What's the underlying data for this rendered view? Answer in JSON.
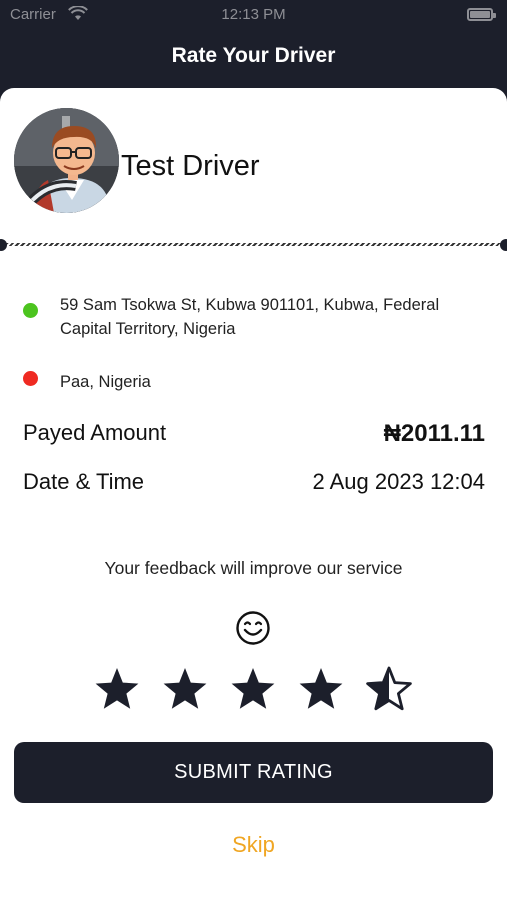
{
  "status_bar": {
    "carrier": "Carrier",
    "time": "12:13 PM"
  },
  "header": {
    "title": "Rate Your Driver"
  },
  "driver": {
    "name": "Test Driver"
  },
  "trip": {
    "pickup": {
      "address": "59 Sam Tsokwa St, Kubwa 901101, Kubwa, Federal Capital Territory, Nigeria",
      "color": "#4cc41f"
    },
    "dropoff": {
      "address": "Paa, Nigeria",
      "color": "#ef2a22"
    },
    "payed_label": "Payed Amount",
    "payed_value": "₦2011.11",
    "datetime_label": "Date & Time",
    "datetime_value": "2 Aug 2023 12:04"
  },
  "rating": {
    "prompt": "Your feedback will improve our service",
    "value": 4.5,
    "max": 5
  },
  "actions": {
    "submit_label": "SUBMIT RATING",
    "skip_label": "Skip"
  },
  "colors": {
    "dark": "#1c1f2b",
    "accent": "#f0a623"
  }
}
